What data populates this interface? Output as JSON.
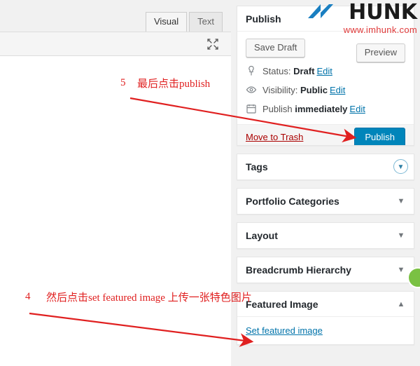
{
  "editor": {
    "tabs": [
      {
        "label": "Visual",
        "active": true
      },
      {
        "label": "Text",
        "active": false
      }
    ],
    "fullscreen_icon": "fullscreen-icon"
  },
  "sidebar": {
    "publish": {
      "title": "Publish",
      "save_draft_label": "Save Draft",
      "preview_label": "Preview",
      "status": {
        "icon": "pin-icon",
        "label": "Status:",
        "value": "Draft",
        "edit": "Edit"
      },
      "visibility": {
        "icon": "eye-icon",
        "label": "Visibility:",
        "value": "Public",
        "edit": "Edit"
      },
      "schedule": {
        "icon": "calendar-icon",
        "label": "Publish",
        "value": "immediately",
        "edit": "Edit"
      },
      "trash_label": "Move to Trash",
      "publish_label": "Publish"
    },
    "tags": {
      "title": "Tags",
      "toggle": "▼"
    },
    "portfolio_categories": {
      "title": "Portfolio Categories",
      "toggle": "▼"
    },
    "layout": {
      "title": "Layout",
      "toggle": "▼"
    },
    "breadcrumb_hierarchy": {
      "title": "Breadcrumb Hierarchy",
      "toggle": "▼"
    },
    "featured_image": {
      "title": "Featured Image",
      "toggle": "▲",
      "set_link": "Set featured image"
    }
  },
  "watermark": {
    "brand": "HUNK",
    "url": "www.imhunk.com",
    "brand_color": "#1b1b1b",
    "url_color": "#e03a3a",
    "mark_color": "#1a7fc1"
  },
  "annotations": {
    "accent_color": "#e02020",
    "items": [
      {
        "number": "5",
        "text": "最后点击publish"
      },
      {
        "number": "4",
        "text": "然后点击set featured image 上传一张特色图片"
      }
    ]
  }
}
